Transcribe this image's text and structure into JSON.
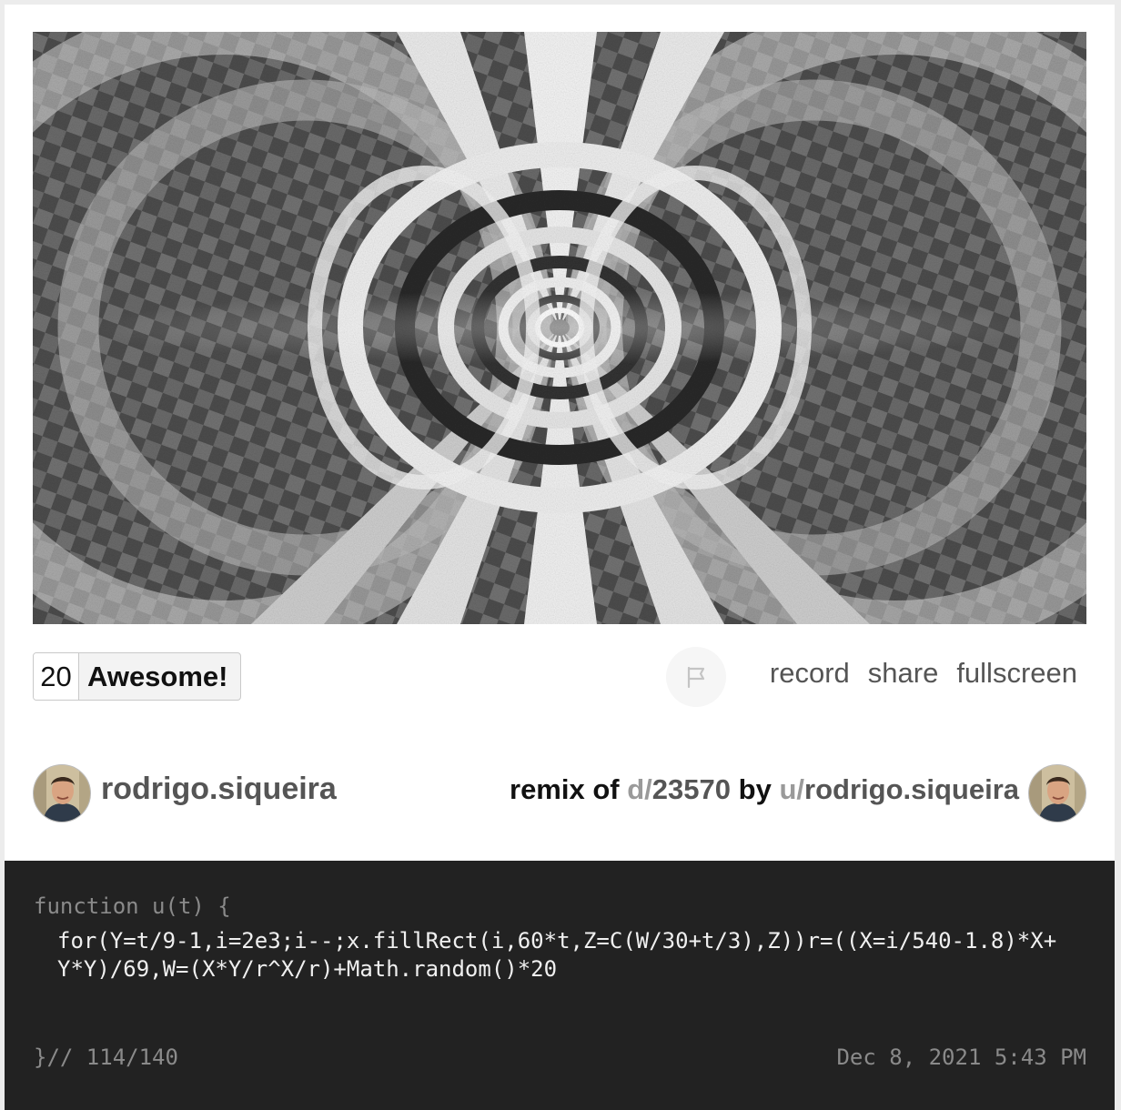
{
  "vote": {
    "count": "20",
    "label": "Awesome!"
  },
  "actions": {
    "record": "record",
    "share": "share",
    "fullscreen": "fullscreen"
  },
  "author": {
    "name": "rodrigo.siqueira"
  },
  "remix": {
    "prefix": "remix of",
    "d_prefix": "d/",
    "dwitter_id": "23570",
    "by": "by",
    "u_prefix": "u/",
    "user": "rodrigo.siqueira"
  },
  "code": {
    "header": "function u(t) {",
    "body": "for(Y=t/9-1,i=2e3;i--;x.fillRect(i,60*t,Z=C(W/30+t/3),Z))r=((X=i/540-1.8)*X+Y*Y)/69,W=(X*Y/r^X/r)+Math.random()*20",
    "footer": "}// 114/140",
    "date": "Dec 8, 2021 5:43 PM"
  },
  "icons": {
    "flag": "flag-icon",
    "avatar": "avatar-photo"
  },
  "colors": {
    "code_bg": "#222222",
    "code_text": "#f0f0f0",
    "muted": "#9a9a9a"
  }
}
